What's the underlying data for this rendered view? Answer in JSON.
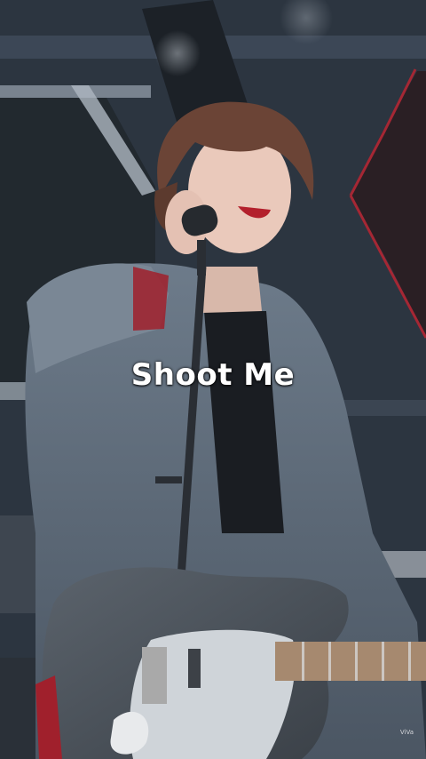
{
  "caption": "Shoot Me",
  "watermark": "ViVa"
}
